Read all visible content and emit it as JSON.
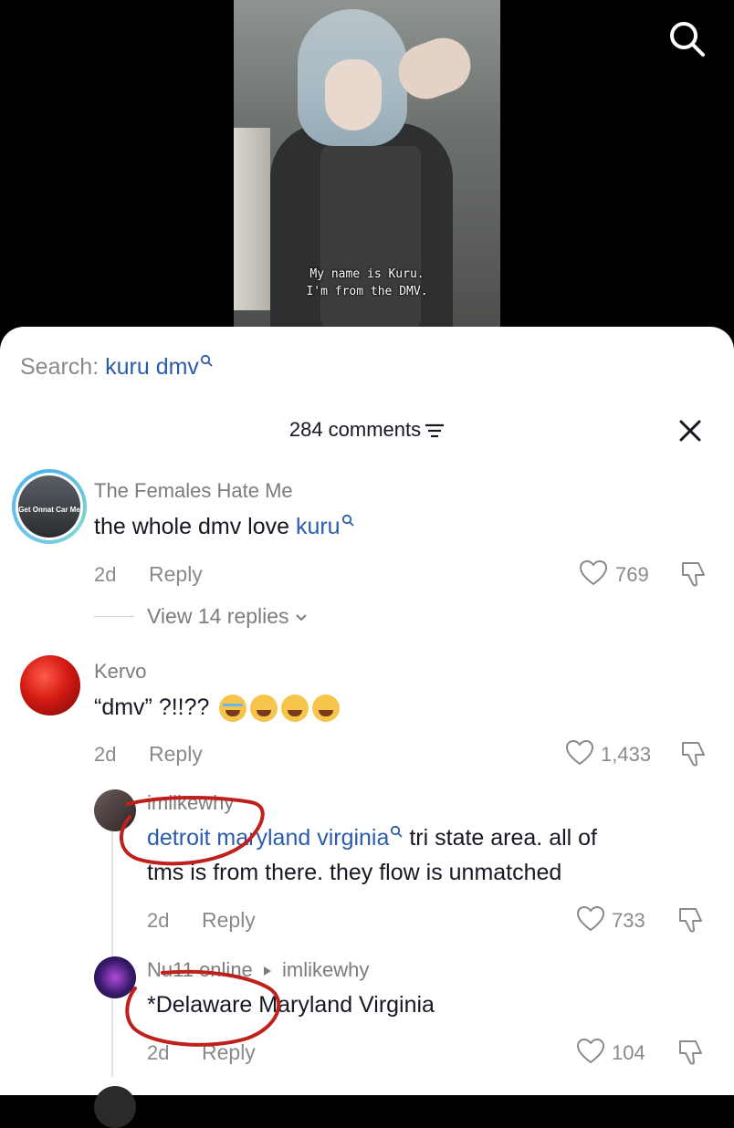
{
  "video": {
    "subtitle_line1": "My name is Kuru.",
    "subtitle_line2": "I'm from the DMV."
  },
  "search": {
    "label": "Search:",
    "query": "kuru dmv"
  },
  "comments_header": {
    "count_text": "284 comments"
  },
  "comments": [
    {
      "author": "The Females Hate Me",
      "avatar_text": "Get Onnat Car Me",
      "text_plain": "the whole dmv love ",
      "text_link": "kuru",
      "age": "2d",
      "reply_label": "Reply",
      "likes": "769",
      "view_replies": "View 14 replies"
    },
    {
      "author": "Kervo",
      "text_plain": "“dmv” ?!!?? ",
      "age": "2d",
      "reply_label": "Reply",
      "likes": "1,433"
    }
  ],
  "replies": [
    {
      "author": "imlikewhy",
      "text_link": "detroit maryland virginia",
      "text_plain_line1": " tri state area. all of",
      "text_plain_line2": "tms is from there. they flow is unmatched",
      "age": "2d",
      "reply_label": "Reply",
      "likes": "733"
    },
    {
      "author": "Nu11 online",
      "reply_to": "imlikewhy",
      "text_plain": "*Delaware Maryland Virginia",
      "age": "2d",
      "reply_label": "Reply",
      "likes": "104"
    }
  ],
  "colors": {
    "link": "#2b5cab",
    "annotation_red": "#c0201b"
  }
}
